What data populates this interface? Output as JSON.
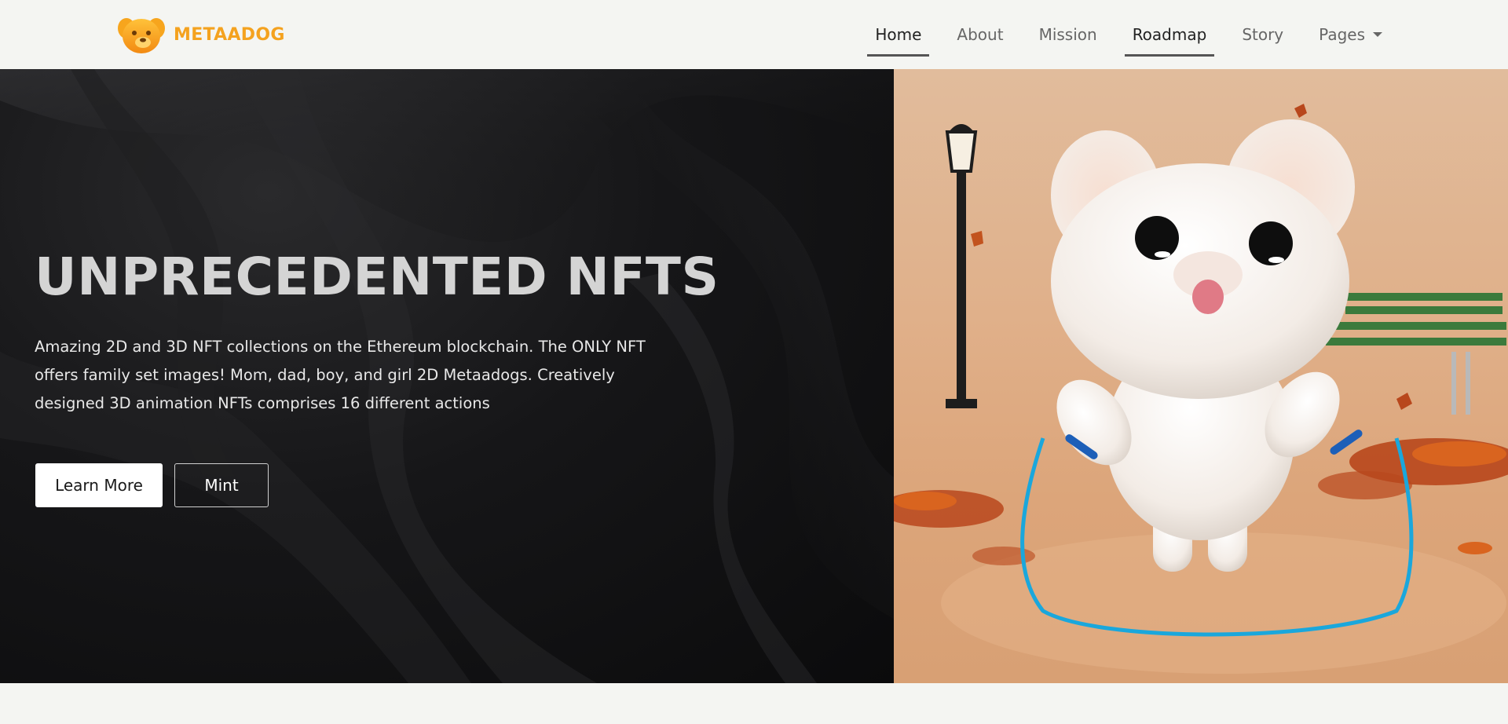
{
  "brand": {
    "name": "METAADOG",
    "logo_icon": "dog-face-logo-icon"
  },
  "nav": {
    "items": [
      {
        "label": "Home"
      },
      {
        "label": "About"
      },
      {
        "label": "Mission"
      },
      {
        "label": "Roadmap"
      },
      {
        "label": "Story"
      },
      {
        "label": "Pages"
      }
    ]
  },
  "hero": {
    "title": "UNPRECEDENTED NFTS",
    "description": "Amazing 2D and 3D NFT collections on the Ethereum blockchain. The ONLY NFT offers family set images! Mom, dad, boy, and girl 2D Metaadogs. Creatively designed 3D animation NFTs comprises 16 different actions",
    "learn_more_label": "Learn More",
    "mint_label": "Mint"
  },
  "colors": {
    "brand_accent": "#f4a21f",
    "header_bg": "#f4f5f2",
    "hero_dark": "#0b0b0c",
    "hero_peach": "#dca57a",
    "rope_blue": "#1aa7dc"
  }
}
